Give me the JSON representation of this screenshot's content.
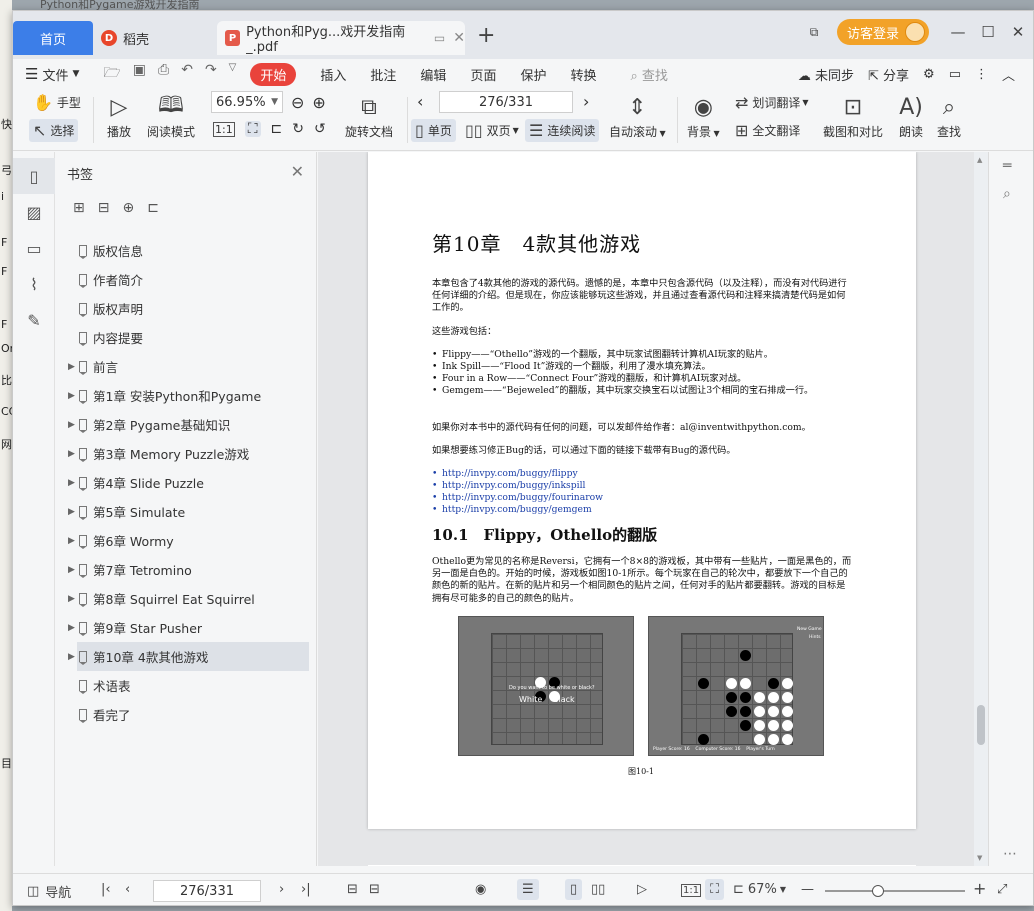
{
  "desktop_edge_texts": [
    "快",
    "弓",
    "i",
    "F",
    "F",
    "F",
    "Or",
    "比",
    "CC",
    "网",
    "目"
  ],
  "background_tab_text": "Python和Pygame游戏开发指南",
  "tabs": {
    "home": "首页",
    "docer": "稻壳",
    "doc": "Python和Pyg...戏开发指南_.pdf"
  },
  "window": {
    "login": "访客登录"
  },
  "menu": {
    "file": "文件",
    "start": "开始",
    "items": [
      "插入",
      "批注",
      "编辑",
      "页面",
      "保护",
      "转换"
    ],
    "search": "查找",
    "sync": "未同步",
    "share": "分享"
  },
  "toolbar": {
    "hand": "手型",
    "select": "选择",
    "play": "播放",
    "read_mode": "阅读模式",
    "zoom_value": "66.95%",
    "rotate": "旋转文档",
    "page_value": "276/331",
    "single": "单页",
    "double": "双页",
    "continuous": "连续阅读",
    "auto_scroll": "自动滚动",
    "background": "背景",
    "word_translate": "划词翻译",
    "full_translate": "全文翻译",
    "screenshot_compare": "截图和对比",
    "read_aloud": "朗读",
    "find": "查找"
  },
  "bookmarks": {
    "title": "书签",
    "items": [
      {
        "label": "版权信息",
        "expandable": false
      },
      {
        "label": "作者简介",
        "expandable": false
      },
      {
        "label": "版权声明",
        "expandable": false
      },
      {
        "label": "内容提要",
        "expandable": false
      },
      {
        "label": "前言",
        "expandable": true
      },
      {
        "label": "第1章 安装Python和Pygame",
        "expandable": true
      },
      {
        "label": "第2章 Pygame基础知识",
        "expandable": true
      },
      {
        "label": "第3章 Memory Puzzle游戏",
        "expandable": true
      },
      {
        "label": "第4章 Slide Puzzle",
        "expandable": true
      },
      {
        "label": "第5章 Simulate",
        "expandable": true
      },
      {
        "label": "第6章 Wormy",
        "expandable": true
      },
      {
        "label": "第7章 Tetromino",
        "expandable": true
      },
      {
        "label": "第8章 Squirrel Eat Squirrel",
        "expandable": true
      },
      {
        "label": "第9章 Star Pusher",
        "expandable": true
      },
      {
        "label": "第10章 4款其他游戏",
        "expandable": true,
        "selected": true
      },
      {
        "label": "术语表",
        "expandable": false
      },
      {
        "label": "看完了",
        "expandable": false
      }
    ]
  },
  "page": {
    "chapter_title": "第10章　4款其他游戏",
    "intro": "本章包含了4款其他的游戏的源代码。遗憾的是，本章中只包含源代码（以及注释），而没有对代码进行任何详细的介绍。但是现在，你应该能够玩这些游戏，并且通过查看源代码和注释来搞清楚代码是如何工作的。",
    "games_intro": "这些游戏包括：",
    "games": [
      "Flippy——“Othello”游戏的一个翻版，其中玩家试图翻转计算机AI玩家的贴片。",
      "Ink Spill——“Flood It”游戏的一个翻版，利用了漫水填充算法。",
      "Four in a Row——“Connect Four”游戏的翻版，和计算机AI玩家对战。",
      "Gemgem——“Bejeweled”的翻版，其中玩家交换宝石以试图让3个相同的宝石排成一行。"
    ],
    "email_line": "如果你对本书中的源代码有任何的问题，可以发邮件给作者：al@inventwithpython.com。",
    "bug_line": "如果想要练习修正Bug的话，可以通过下面的链接下载带有Bug的源代码。",
    "links": [
      "http://invpy.com/buggy/flippy",
      "http://invpy.com/buggy/inkspill",
      "http://invpy.com/buggy/fourinarow",
      "http://invpy.com/buggy/gemgem"
    ],
    "section_title": "10.1　Flippy，Othello的翻版",
    "section_text": "Othello更为常见的名称是Reversi，它拥有一个8×8的游戏板，其中带有一些贴片，一面是黑色的，而另一面是白色的。开始的时候，游戏板如图10-1所示。每个玩家在自己的轮次中，都要放下一个自己的颜色的新的贴片。在新的贴片和另一个相同颜色的贴片之间，任何对手的贴片都要翻转。游戏的目标是拥有尽可能多的自己的颜色的贴片。",
    "fig_left_prompt": "Do you want to be white or black?",
    "fig_left_white": "White",
    "fig_left_black": "Black",
    "fig_right_new": "New Game",
    "fig_right_hints": "Hints",
    "fig_right_status": "Player Score: 16    Computer Score: 16    Player's Turn",
    "figure_caption": "图10-1"
  },
  "status": {
    "nav": "导航",
    "page_value": "276/331",
    "zoom": "67%",
    "zoom_fraction": 0.38
  }
}
